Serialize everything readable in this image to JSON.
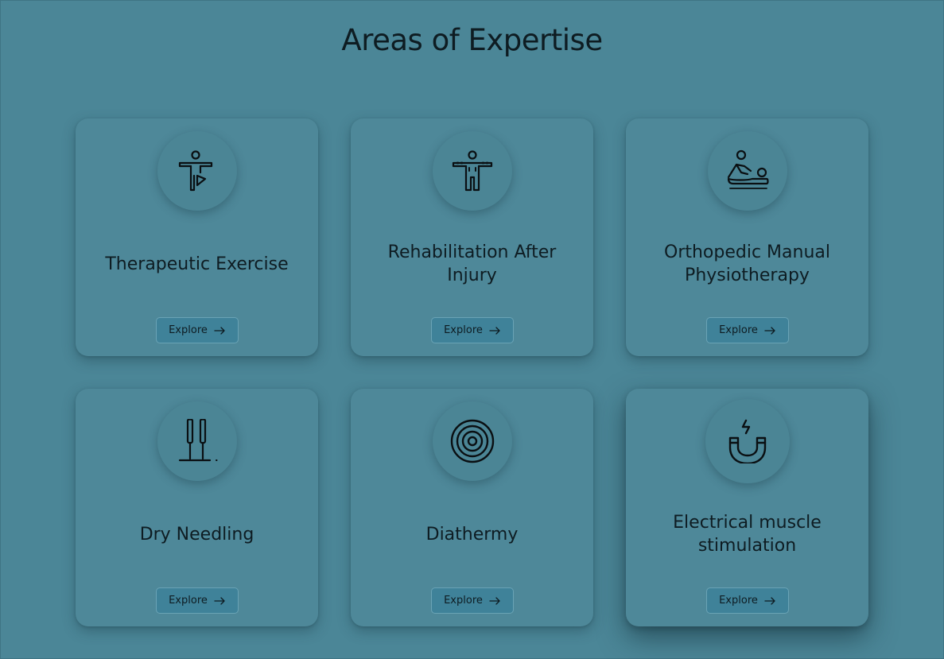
{
  "page": {
    "title": "Areas of Expertise"
  },
  "cards": [
    {
      "title": "Therapeutic Exercise",
      "button": "Explore",
      "icon": "exercise-figure-icon"
    },
    {
      "title": "Rehabilitation After Injury",
      "button": "Explore",
      "icon": "rehab-figure-icon"
    },
    {
      "title": "Orthopedic Manual Physiotherapy",
      "button": "Explore",
      "icon": "massage-icon"
    },
    {
      "title": "Dry Needling",
      "button": "Explore",
      "icon": "needles-icon"
    },
    {
      "title": "Diathermy",
      "button": "Explore",
      "icon": "concentric-circles-icon"
    },
    {
      "title": "Electrical muscle stimulation",
      "button": "Explore",
      "icon": "magnet-icon"
    }
  ],
  "colors": {
    "background": "#4b8697",
    "card": "#4e8899",
    "button": "#3f8299",
    "text": "#0e1c22"
  }
}
